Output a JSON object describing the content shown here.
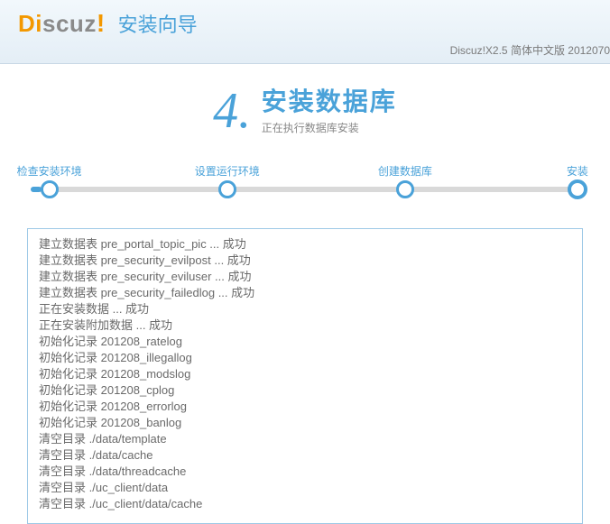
{
  "header": {
    "brand_d": "D",
    "brand_i": "i",
    "brand_rest": "scuz",
    "brand_excl": "!",
    "wizard_title": "安装向导",
    "meta": "Discuz!X2.5 简体中文版 2012070"
  },
  "step_panel": {
    "number": "4.",
    "title": "安装数据库",
    "subtitle": "正在执行数据库安装"
  },
  "steps": [
    {
      "label": "检查安装环境",
      "pos": 4
    },
    {
      "label": "设置运行环境",
      "pos": 36
    },
    {
      "label": "创建数据库",
      "pos": 68
    },
    {
      "label": "安装",
      "pos": 99
    }
  ],
  "current_step_index": 3,
  "log": [
    "建立数据表 pre_portal_topic_pic ... 成功",
    "建立数据表 pre_security_evilpost ... 成功",
    "建立数据表 pre_security_eviluser ... 成功",
    "建立数据表 pre_security_failedlog ... 成功",
    "正在安装数据 ... 成功",
    "正在安装附加数据 ... 成功",
    "初始化记录 201208_ratelog",
    "初始化记录 201208_illegallog",
    "初始化记录 201208_modslog",
    "初始化记录 201208_cplog",
    "初始化记录 201208_errorlog",
    "初始化记录 201208_banlog",
    "清空目录 ./data/template",
    "清空目录 ./data/cache",
    "清空目录 ./data/threadcache",
    "清空目录 ./uc_client/data",
    "清空目录 ./uc_client/data/cache"
  ]
}
